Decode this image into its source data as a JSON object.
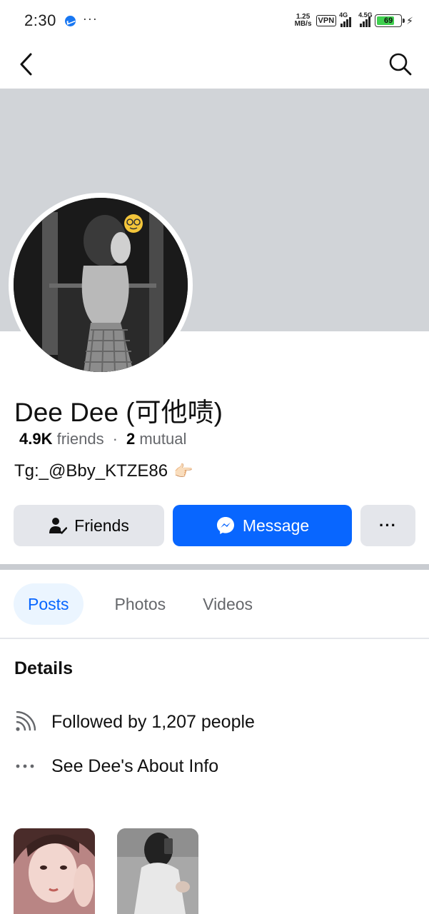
{
  "status_bar": {
    "time": "2:30",
    "dots": "···",
    "speed_value": "1.25",
    "speed_unit": "MB/s",
    "vpn": "VPN",
    "network_1": "4G",
    "network_2": "4.5G",
    "battery": "69"
  },
  "profile": {
    "name": "Dee Dee (可他啧)",
    "friends_count": "4.9K",
    "friends_label": "friends",
    "separator": "·",
    "mutual_count": "2",
    "mutual_label": "mutual",
    "bio": "Tg:_@Bby_KTZE86",
    "bio_emoji": "👉🏻"
  },
  "actions": {
    "friends_label": "Friends",
    "message_label": "Message",
    "more_label": "···"
  },
  "tabs": [
    {
      "label": "Posts",
      "active": true
    },
    {
      "label": "Photos",
      "active": false
    },
    {
      "label": "Videos",
      "active": false
    }
  ],
  "details": {
    "title": "Details",
    "followers": "Followed by 1,207 people",
    "about": "See Dee's About Info"
  },
  "colors": {
    "accent": "#0866ff",
    "cover": "#d1d4d8",
    "button_gray": "#e4e6eb",
    "active_tab_bg": "#ebf5ff"
  }
}
